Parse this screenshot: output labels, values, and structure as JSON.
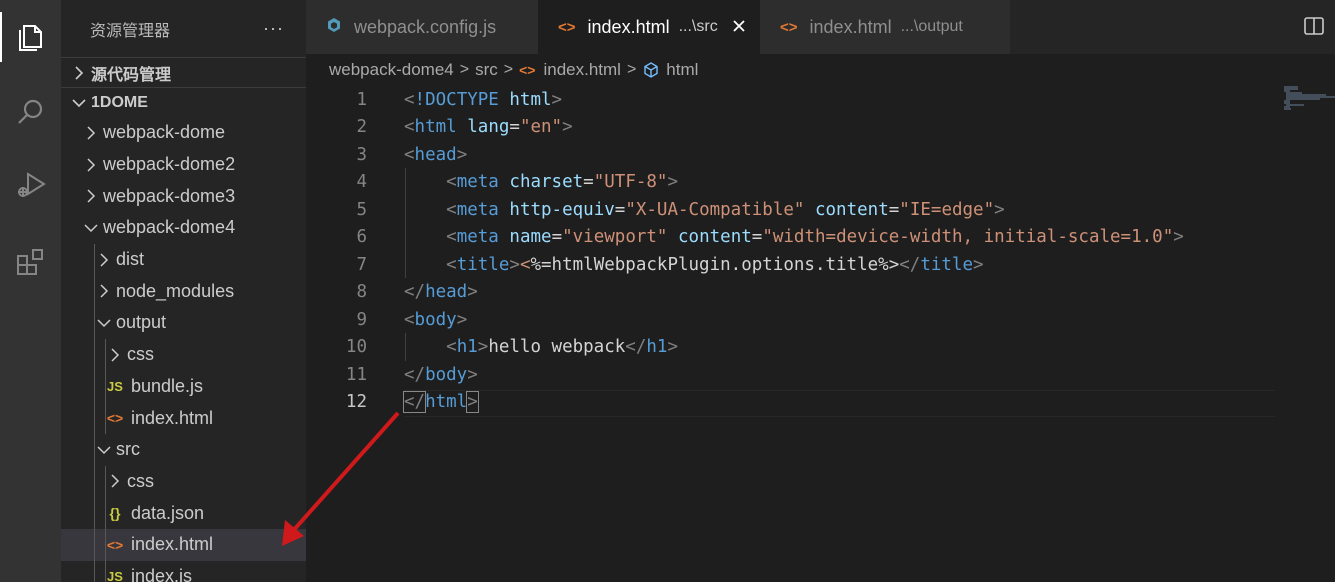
{
  "activity_bar": {
    "icons": [
      "files-icon",
      "search-icon",
      "run-debug-icon",
      "extensions-icon"
    ]
  },
  "sidebar": {
    "title": "资源管理器",
    "more": "···",
    "sections": {
      "source_control": "源代码管理",
      "workspace": "1DOME"
    },
    "tree": [
      {
        "label": "webpack-dome",
        "type": "folder",
        "open": false,
        "depth": 1
      },
      {
        "label": "webpack-dome2",
        "type": "folder",
        "open": false,
        "depth": 1
      },
      {
        "label": "webpack-dome3",
        "type": "folder",
        "open": false,
        "depth": 1
      },
      {
        "label": "webpack-dome4",
        "type": "folder",
        "open": true,
        "depth": 1
      },
      {
        "label": "dist",
        "type": "folder",
        "open": false,
        "depth": 2
      },
      {
        "label": "node_modules",
        "type": "folder",
        "open": false,
        "depth": 2
      },
      {
        "label": "output",
        "type": "folder",
        "open": true,
        "depth": 2
      },
      {
        "label": "css",
        "type": "folder",
        "open": false,
        "depth": 3
      },
      {
        "label": "bundle.js",
        "type": "js",
        "depth": 3
      },
      {
        "label": "index.html",
        "type": "html",
        "depth": 3
      },
      {
        "label": "src",
        "type": "folder",
        "open": true,
        "depth": 2
      },
      {
        "label": "css",
        "type": "folder",
        "open": false,
        "depth": 3
      },
      {
        "label": "data.json",
        "type": "json",
        "depth": 3
      },
      {
        "label": "index.html",
        "type": "html",
        "depth": 3,
        "selected": true
      },
      {
        "label": "index.js",
        "type": "js",
        "depth": 3
      }
    ],
    "file_icons": {
      "js": "JS",
      "html": "<>",
      "json": "{}"
    }
  },
  "tabs": [
    {
      "label": "webpack.config.js",
      "desc": "",
      "icon": "webpack-icon",
      "active": false
    },
    {
      "label": "index.html",
      "desc": "...\\src",
      "icon": "html-icon",
      "active": true
    },
    {
      "label": "index.html",
      "desc": "...\\output",
      "icon": "html-icon",
      "active": false
    }
  ],
  "breadcrumbs": [
    "webpack-dome4",
    "src",
    "index.html",
    "html"
  ],
  "editor": {
    "current_line": 12,
    "lines": [
      [
        [
          "<",
          "punc"
        ],
        [
          "!DOCTYPE",
          "tag"
        ],
        [
          " ",
          "text"
        ],
        [
          "html",
          "attr"
        ],
        [
          ">",
          "punc"
        ]
      ],
      [
        [
          "<",
          "punc"
        ],
        [
          "html",
          "tag"
        ],
        [
          " ",
          "text"
        ],
        [
          "lang",
          "attr"
        ],
        [
          "=",
          "text"
        ],
        [
          "\"en\"",
          "str"
        ],
        [
          ">",
          "punc"
        ]
      ],
      [
        [
          "<",
          "punc"
        ],
        [
          "head",
          "tag"
        ],
        [
          ">",
          "punc"
        ]
      ],
      [
        [
          "    ",
          "text"
        ],
        [
          "<",
          "punc"
        ],
        [
          "meta",
          "tag"
        ],
        [
          " ",
          "text"
        ],
        [
          "charset",
          "attr"
        ],
        [
          "=",
          "text"
        ],
        [
          "\"UTF-8\"",
          "str"
        ],
        [
          ">",
          "punc"
        ]
      ],
      [
        [
          "    ",
          "text"
        ],
        [
          "<",
          "punc"
        ],
        [
          "meta",
          "tag"
        ],
        [
          " ",
          "text"
        ],
        [
          "http-equiv",
          "attr"
        ],
        [
          "=",
          "text"
        ],
        [
          "\"X-UA-Compatible\"",
          "str"
        ],
        [
          " ",
          "text"
        ],
        [
          "content",
          "attr"
        ],
        [
          "=",
          "text"
        ],
        [
          "\"IE=edge\"",
          "str"
        ],
        [
          ">",
          "punc"
        ]
      ],
      [
        [
          "    ",
          "text"
        ],
        [
          "<",
          "punc"
        ],
        [
          "meta",
          "tag"
        ],
        [
          " ",
          "text"
        ],
        [
          "name",
          "attr"
        ],
        [
          "=",
          "text"
        ],
        [
          "\"viewport\"",
          "str"
        ],
        [
          " ",
          "text"
        ],
        [
          "content",
          "attr"
        ],
        [
          "=",
          "text"
        ],
        [
          "\"width=device-width, initial-scale=1.0\"",
          "str"
        ],
        [
          ">",
          "punc"
        ]
      ],
      [
        [
          "    ",
          "text"
        ],
        [
          "<",
          "punc"
        ],
        [
          "title",
          "tag"
        ],
        [
          ">",
          "punc"
        ],
        [
          "<",
          "str"
        ],
        [
          "%=htmlWebpackPlugin.options.title%>",
          "text"
        ],
        [
          "</",
          "punc"
        ],
        [
          "title",
          "tag"
        ],
        [
          ">",
          "punc"
        ]
      ],
      [
        [
          "</",
          "punc"
        ],
        [
          "head",
          "tag"
        ],
        [
          ">",
          "punc"
        ]
      ],
      [
        [
          "<",
          "punc"
        ],
        [
          "body",
          "tag"
        ],
        [
          ">",
          "punc"
        ]
      ],
      [
        [
          "    ",
          "text"
        ],
        [
          "<",
          "punc"
        ],
        [
          "h1",
          "tag"
        ],
        [
          ">",
          "punc"
        ],
        [
          "hello webpack",
          "text"
        ],
        [
          "</",
          "punc"
        ],
        [
          "h1",
          "tag"
        ],
        [
          ">",
          "punc"
        ]
      ],
      [
        [
          "</",
          "punc"
        ],
        [
          "body",
          "tag"
        ],
        [
          ">",
          "punc"
        ]
      ],
      [
        [
          "</",
          "punc"
        ],
        [
          "html",
          "tag"
        ],
        [
          ">",
          "punc"
        ]
      ]
    ]
  },
  "colors": {
    "annotation_arrow": "#d0191b",
    "html_icon": "#e37933",
    "webpack_icon": "#519aba"
  }
}
